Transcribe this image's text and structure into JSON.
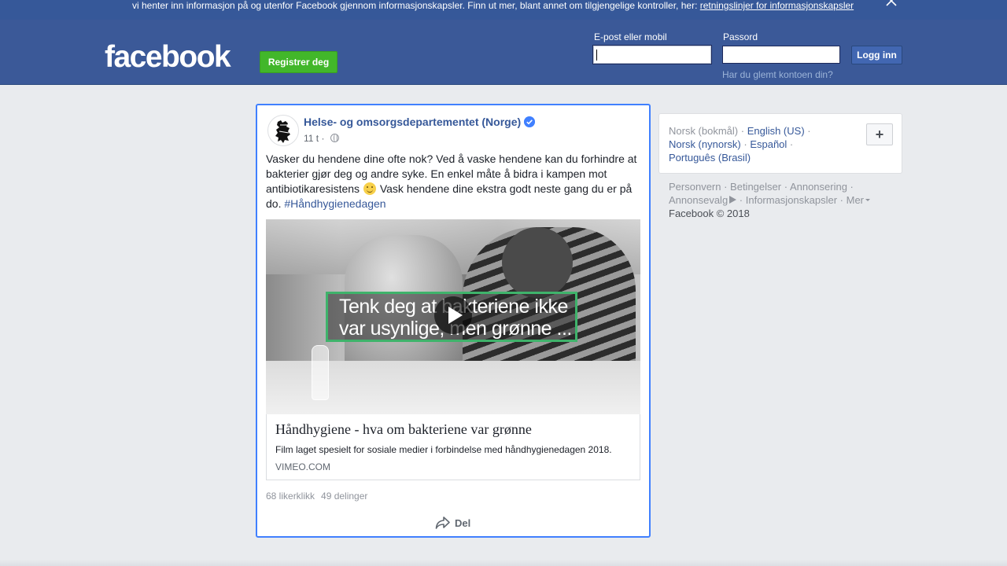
{
  "cookie_banner": {
    "text": "vi henter inn informasjon på og utenfor Facebook gjennom informasjonskapsler. Finn ut mer, blant annet om tilgjengelige kontroller, her: ",
    "link": "retningslinjer for informasjonskapsler",
    "close_icon": "close-icon"
  },
  "header": {
    "logo": "facebook",
    "register_label": "Registrer deg",
    "email_label": "E-post eller mobil",
    "email_value": "",
    "password_label": "Passord",
    "password_value": "",
    "login_label": "Logg inn",
    "forgot_link": "Har du glemt kontoen din?",
    "colors": {
      "brand": "#3b5998",
      "register_green": "#42b72a"
    }
  },
  "post": {
    "page_name": "Helse- og omsorgsdepartementet (Norge)",
    "verified_icon": "verified-badge-icon",
    "time": "11 t",
    "time_separator": " · ",
    "privacy_icon": "globe-icon",
    "text_part1": "Vasker du hendene dine ofte nok? Ved å vaske hendene kan du forhindre at bakterier gjør deg og andre syke. En enkel måte å bidra i kampen mot antibiotikaresistens ",
    "emoji_icon": "smiley-icon",
    "text_part2": " Vask hendene dine ekstra godt neste gang du er på do. ",
    "hashtag": "#Håndhygienedagen",
    "video": {
      "caption": "Tenk deg at bakteriene ikke\nvar usynlige, men grønne ...",
      "play_icon": "play-icon",
      "accent": "#3fb36b"
    },
    "link_card": {
      "title": "Håndhygiene - hva om bakteriene var grønne",
      "description": "Film laget spesielt for sosiale medier i forbindelse med håndhygienedagen 2018.",
      "domain": "VIMEO.COM"
    },
    "likes": "68 likerklikk",
    "shares": "49 delinger",
    "share_label": "Del",
    "share_icon": "share-arrow-icon"
  },
  "languages": {
    "current": "Norsk (bokmål)",
    "options": [
      "English (US)",
      "Norsk (nynorsk)",
      "Español",
      "Português (Brasil)"
    ],
    "add_label": "+",
    "separator": " · "
  },
  "footer": {
    "links": [
      "Personvern",
      "Betingelser",
      "Annonsering",
      "Annonsevalg",
      "Informasjonskapsler",
      "Mer"
    ],
    "copyright": "Facebook © 2018"
  }
}
